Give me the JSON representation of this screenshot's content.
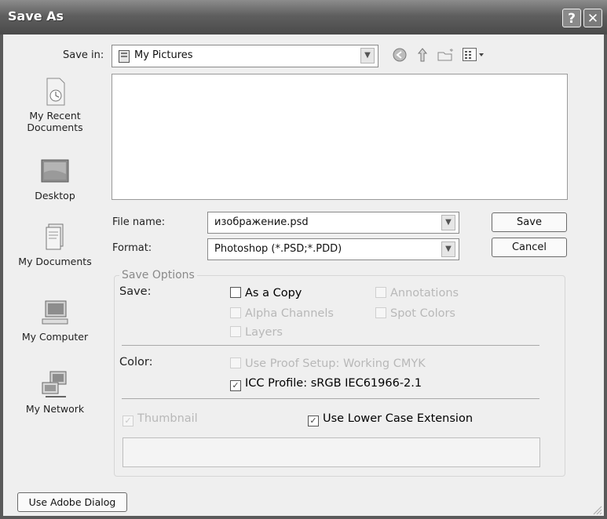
{
  "window": {
    "title": "Save As",
    "help_label": "?",
    "close_label": "✕"
  },
  "save_in": {
    "label": "Save in:",
    "value": "My Pictures"
  },
  "places": [
    {
      "label_line1": "My Recent",
      "label_line2": "Documents",
      "icon": "recent-documents-icon"
    },
    {
      "label_line1": "Desktop",
      "label_line2": "",
      "icon": "desktop-icon"
    },
    {
      "label_line1": "My Documents",
      "label_line2": "",
      "icon": "my-documents-icon"
    },
    {
      "label_line1": "My Computer",
      "label_line2": "",
      "icon": "my-computer-icon"
    },
    {
      "label_line1": "My Network",
      "label_line2": "",
      "icon": "my-network-icon"
    }
  ],
  "file_name": {
    "label": "File name:",
    "value": "изображение.psd"
  },
  "format": {
    "label": "Format:",
    "value": "Photoshop (*.PSD;*.PDD)"
  },
  "buttons": {
    "save": "Save",
    "cancel": "Cancel",
    "adobe": "Use Adobe Dialog"
  },
  "save_options": {
    "legend": "Save Options",
    "save_label": "Save:",
    "as_copy": {
      "label": "As a Copy",
      "checked": false,
      "enabled": true
    },
    "annotations": {
      "label": "Annotations",
      "checked": false,
      "enabled": false
    },
    "alpha_channels": {
      "label": "Alpha Channels",
      "checked": false,
      "enabled": false
    },
    "spot_colors": {
      "label": "Spot Colors",
      "checked": false,
      "enabled": false
    },
    "layers": {
      "label": "Layers",
      "checked": false,
      "enabled": false
    },
    "color_label": "Color:",
    "use_proof_setup": {
      "label": "Use Proof Setup:  Working CMYK",
      "checked": false,
      "enabled": false
    },
    "icc_profile": {
      "label": "ICC Profile:  sRGB IEC61966-2.1",
      "checked": true,
      "enabled": true
    },
    "thumbnail": {
      "label": "Thumbnail",
      "checked": true,
      "enabled": false
    },
    "lower_case": {
      "label": "Use Lower Case Extension",
      "checked": true,
      "enabled": true
    }
  }
}
